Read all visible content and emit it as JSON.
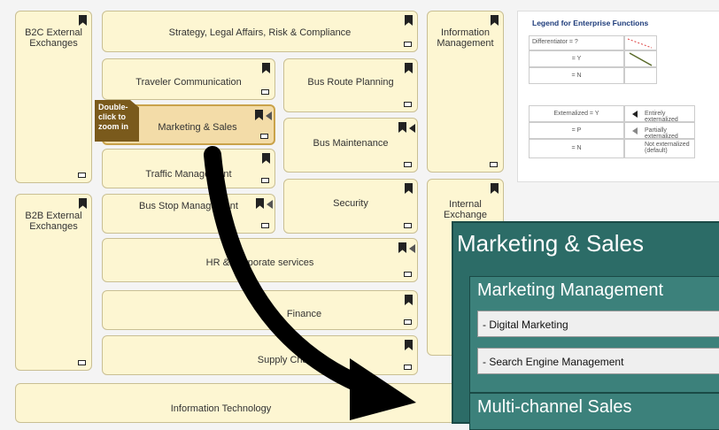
{
  "boxes": {
    "b2c": "B2C External Exchanges",
    "strategy": "Strategy, Legal Affairs, Risk & Compliance",
    "info_mgmt": "Information Management",
    "traveler": "Traveler Communication",
    "bus_route": "Bus Route Planning",
    "marketing": "Marketing & Sales",
    "bus_maint": "Bus Maintenance",
    "traffic": "Traffic Management",
    "b2b": "B2B External Exchanges",
    "bus_stop": "Bus Stop Management",
    "security": "Security",
    "internal": "Internal Exchange",
    "hr": "HR & Corporate services",
    "finance": "Finance",
    "supply": "Supply Chain",
    "it": "Information Technology"
  },
  "tooltip": "Double-click to zoom in",
  "legend": {
    "title": "Legend for Enterprise Functions",
    "diff_y": "Differentiator = ?",
    "eq_y": "= Y",
    "eq_n": "= N",
    "ext_y": "Externalized = Y",
    "ext_p": "= P",
    "ext_n": "= N",
    "entirely": "Entirely externalized",
    "partially": "Partially externalized",
    "not_ext": "Not externalized (default)"
  },
  "popup": {
    "title": "Marketing & Sales",
    "group1": "Marketing Management",
    "item1": "- Digital Marketing",
    "item2": "- Search Engine Management",
    "group2": "Multi-channel Sales"
  },
  "colors": {
    "box_fill": "#fdf6d2",
    "popup_bg": "#2c6c67",
    "tooltip_bg": "#7a5a1c"
  }
}
